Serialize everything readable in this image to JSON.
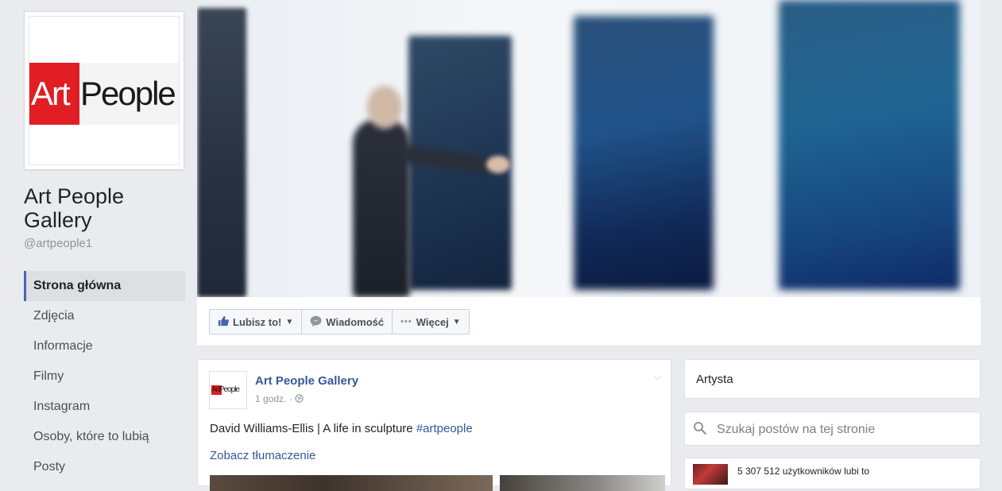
{
  "profile": {
    "logo_art": "Art",
    "logo_people": "People",
    "name": "Art People Gallery",
    "handle": "@artpeople1"
  },
  "nav": {
    "items": [
      {
        "label": "Strona główna",
        "active": true
      },
      {
        "label": "Zdjęcia"
      },
      {
        "label": "Informacje"
      },
      {
        "label": "Filmy"
      },
      {
        "label": "Instagram"
      },
      {
        "label": "Osoby, które to lubią"
      },
      {
        "label": "Posty"
      }
    ]
  },
  "actions": {
    "like_label": "Lubisz to!",
    "message_label": "Wiadomość",
    "more_label": "Więcej",
    "icons": [
      "thumbs-up-icon",
      "chat-bubble-icon",
      "ellipsis-icon",
      "caret-down-icon"
    ]
  },
  "post": {
    "avatar_logo": "ArtPeople",
    "author": "Art People Gallery",
    "time": "1 godz. ·",
    "text": "David Williams-Ellis | A life in sculpture ",
    "hashtag": "#artpeople",
    "translate": "Zobacz tłumaczenie"
  },
  "sidebar_right": {
    "category": "Artysta",
    "search_placeholder": "Szukaj postów na tej stronie",
    "likes_text": "5 307 512 użytkowników lubi to"
  },
  "colors": {
    "accent": "#4267b2",
    "link": "#365899",
    "logo_red": "#e01e24",
    "background": "#e9ebee"
  }
}
